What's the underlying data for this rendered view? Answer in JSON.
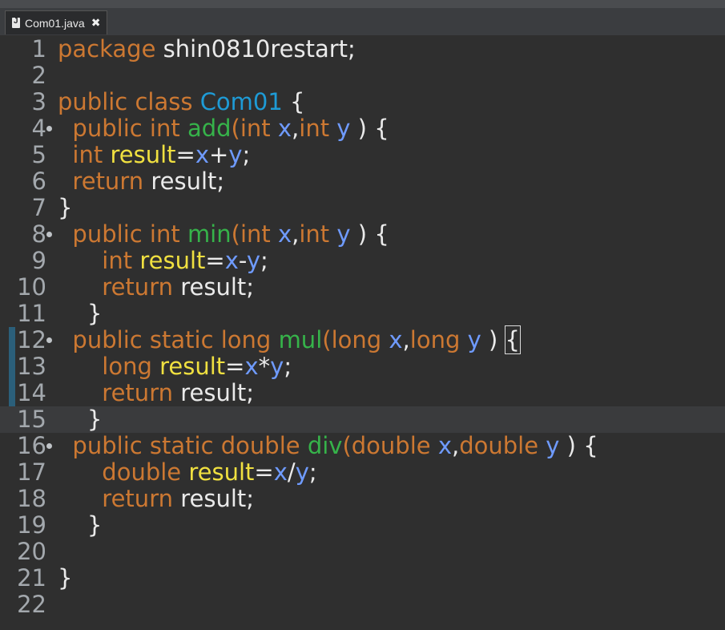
{
  "tab": {
    "title": "Com01.java",
    "close_glyph": "✖"
  },
  "lines": [
    {
      "n": "1",
      "tokens": [
        {
          "t": "package ",
          "c": "kw"
        },
        {
          "t": "shin0810restart;",
          "c": "txt"
        }
      ]
    },
    {
      "n": "2",
      "tokens": []
    },
    {
      "n": "3",
      "tokens": [
        {
          "t": "public class ",
          "c": "kw"
        },
        {
          "t": "Com01",
          "c": "cls"
        },
        {
          "t": " {",
          "c": "txt"
        }
      ]
    },
    {
      "n": "4",
      "fold": true,
      "tokens": [
        {
          "t": "  public int ",
          "c": "kw"
        },
        {
          "t": "add",
          "c": "fn"
        },
        {
          "t": "(int ",
          "c": "kw"
        },
        {
          "t": "x",
          "c": "par"
        },
        {
          "t": ",",
          "c": "txt"
        },
        {
          "t": "int ",
          "c": "kw"
        },
        {
          "t": "y",
          "c": "par"
        },
        {
          "t": " ) {",
          "c": "txt"
        }
      ]
    },
    {
      "n": "5",
      "tokens": [
        {
          "t": "  int ",
          "c": "kw"
        },
        {
          "t": "result",
          "c": "var"
        },
        {
          "t": "=",
          "c": "txt"
        },
        {
          "t": "x",
          "c": "par"
        },
        {
          "t": "+",
          "c": "txt"
        },
        {
          "t": "y",
          "c": "par"
        },
        {
          "t": ";",
          "c": "txt"
        }
      ]
    },
    {
      "n": "6",
      "tokens": [
        {
          "t": "  return ",
          "c": "kw"
        },
        {
          "t": "result;",
          "c": "txt"
        }
      ]
    },
    {
      "n": "7",
      "tokens": [
        {
          "t": "}",
          "c": "txt"
        }
      ]
    },
    {
      "n": "8",
      "fold": true,
      "tokens": [
        {
          "t": "  public int ",
          "c": "kw"
        },
        {
          "t": "min",
          "c": "fn"
        },
        {
          "t": "(int ",
          "c": "kw"
        },
        {
          "t": "x",
          "c": "par"
        },
        {
          "t": ",",
          "c": "txt"
        },
        {
          "t": "int ",
          "c": "kw"
        },
        {
          "t": "y",
          "c": "par"
        },
        {
          "t": " ) {",
          "c": "txt"
        }
      ]
    },
    {
      "n": "9",
      "tokens": [
        {
          "t": "      int ",
          "c": "kw"
        },
        {
          "t": "result",
          "c": "var"
        },
        {
          "t": "=",
          "c": "txt"
        },
        {
          "t": "x",
          "c": "par"
        },
        {
          "t": "-",
          "c": "txt"
        },
        {
          "t": "y",
          "c": "par"
        },
        {
          "t": ";",
          "c": "txt"
        }
      ]
    },
    {
      "n": "10",
      "tokens": [
        {
          "t": "      return ",
          "c": "kw"
        },
        {
          "t": "result;",
          "c": "txt"
        }
      ]
    },
    {
      "n": "11",
      "tokens": [
        {
          "t": "    }",
          "c": "txt"
        }
      ]
    },
    {
      "n": "12",
      "fold": true,
      "marker": true,
      "tokens": [
        {
          "t": "  public static long ",
          "c": "kw"
        },
        {
          "t": "mul",
          "c": "fn"
        },
        {
          "t": "(long ",
          "c": "kw"
        },
        {
          "t": "x",
          "c": "par"
        },
        {
          "t": ",",
          "c": "txt"
        },
        {
          "t": "long ",
          "c": "kw"
        },
        {
          "t": "y",
          "c": "par"
        },
        {
          "t": " ) ",
          "c": "txt"
        },
        {
          "t": "{",
          "c": "txt brace-box"
        }
      ]
    },
    {
      "n": "13",
      "marker": true,
      "tokens": [
        {
          "t": "      long ",
          "c": "kw"
        },
        {
          "t": "result",
          "c": "var"
        },
        {
          "t": "=",
          "c": "txt"
        },
        {
          "t": "x",
          "c": "par"
        },
        {
          "t": "*",
          "c": "txt"
        },
        {
          "t": "y",
          "c": "par"
        },
        {
          "t": ";",
          "c": "txt"
        }
      ]
    },
    {
      "n": "14",
      "marker": true,
      "tokens": [
        {
          "t": "      return ",
          "c": "kw"
        },
        {
          "t": "result;",
          "c": "txt"
        }
      ]
    },
    {
      "n": "15",
      "marker": true,
      "current": true,
      "tokens": [
        {
          "t": "    }",
          "c": "txt"
        }
      ]
    },
    {
      "n": "16",
      "fold": true,
      "tokens": [
        {
          "t": "  public static double ",
          "c": "kw"
        },
        {
          "t": "div",
          "c": "fn"
        },
        {
          "t": "(double ",
          "c": "kw"
        },
        {
          "t": "x",
          "c": "par"
        },
        {
          "t": ",",
          "c": "txt"
        },
        {
          "t": "double ",
          "c": "kw"
        },
        {
          "t": "y",
          "c": "par"
        },
        {
          "t": " ) {",
          "c": "txt"
        }
      ]
    },
    {
      "n": "17",
      "tokens": [
        {
          "t": "      double ",
          "c": "kw"
        },
        {
          "t": "result",
          "c": "var"
        },
        {
          "t": "=",
          "c": "txt"
        },
        {
          "t": "x",
          "c": "par"
        },
        {
          "t": "/",
          "c": "txt"
        },
        {
          "t": "y",
          "c": "par"
        },
        {
          "t": ";",
          "c": "txt"
        }
      ]
    },
    {
      "n": "18",
      "tokens": [
        {
          "t": "      return ",
          "c": "kw"
        },
        {
          "t": "result;",
          "c": "txt"
        }
      ]
    },
    {
      "n": "19",
      "tokens": [
        {
          "t": "    }",
          "c": "txt"
        }
      ]
    },
    {
      "n": "20",
      "tokens": []
    },
    {
      "n": "21",
      "tokens": [
        {
          "t": "}",
          "c": "txt"
        }
      ]
    },
    {
      "n": "22",
      "tokens": []
    }
  ]
}
